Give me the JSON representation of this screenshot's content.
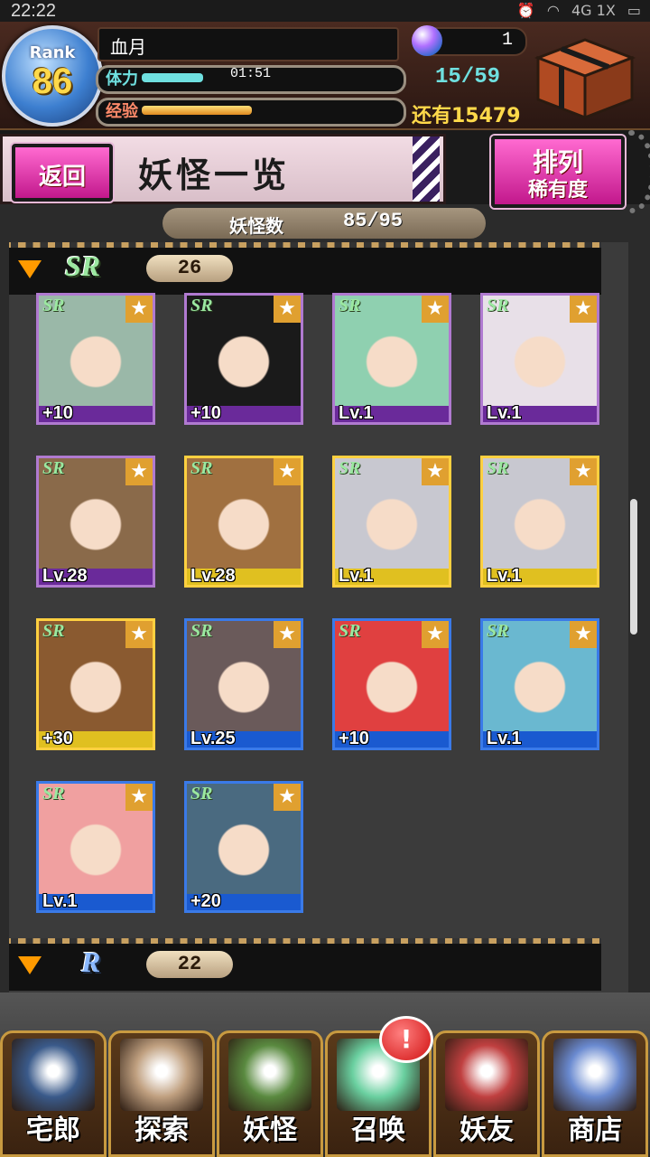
{
  "status_bar": {
    "time": "22:22",
    "network": "4G 1X"
  },
  "header": {
    "rank_label": "Rank",
    "rank_value": "86",
    "player_name": "血月",
    "stamina_label": "体力",
    "stamina_timer": "01:51",
    "stamina_fraction": 0.25,
    "stamina_count": "15/59",
    "exp_label": "经验",
    "exp_fraction": 0.45,
    "exp_remaining": "还有15479",
    "gem_count": "1"
  },
  "titlebar": {
    "back_label": "返回",
    "page_title": "妖怪一览",
    "sort_main": "排列",
    "sort_sub": "稀有度"
  },
  "count_strip": {
    "label": "妖怪数",
    "value": "85/95"
  },
  "groups": [
    {
      "rarity": "SR",
      "count": "26"
    },
    {
      "rarity": "R",
      "count": "22"
    }
  ],
  "cards": [
    {
      "level": "+10",
      "frame": "purple",
      "color": "#9ab8a8"
    },
    {
      "level": "+10",
      "frame": "purple",
      "color": "#1a1a1a"
    },
    {
      "level": "Lv.1",
      "frame": "purple",
      "color": "#8fd0b0"
    },
    {
      "level": "Lv.1",
      "frame": "purple",
      "color": "#e8e0e8"
    },
    {
      "level": "Lv.28",
      "frame": "purple",
      "color": "#8a6a4a"
    },
    {
      "level": "Lv.28",
      "frame": "gold",
      "color": "#a07040"
    },
    {
      "level": "Lv.1",
      "frame": "gold",
      "color": "#c8c8d0"
    },
    {
      "level": "Lv.1",
      "frame": "gold",
      "color": "#c8c8d0"
    },
    {
      "level": "+30",
      "frame": "gold",
      "color": "#8a5a30"
    },
    {
      "level": "Lv.25",
      "frame": "blue",
      "color": "#6a5a5a"
    },
    {
      "level": "+10",
      "frame": "blue",
      "color": "#e04040"
    },
    {
      "level": "Lv.1",
      "frame": "blue",
      "color": "#6ab8d0"
    },
    {
      "level": "Lv.1",
      "frame": "blue",
      "color": "#f0a0a0"
    },
    {
      "level": "+20",
      "frame": "blue",
      "color": "#4a6a80"
    }
  ],
  "nav": [
    {
      "label": "宅郎",
      "icon": "mansion-icon"
    },
    {
      "label": "探索",
      "icon": "magnifier-icon"
    },
    {
      "label": "妖怪",
      "icon": "scroll-icon"
    },
    {
      "label": "召唤",
      "icon": "pentagram-icon"
    },
    {
      "label": "妖友",
      "icon": "friend-icon"
    },
    {
      "label": "商店",
      "icon": "orb-icon"
    }
  ],
  "notification": "!"
}
